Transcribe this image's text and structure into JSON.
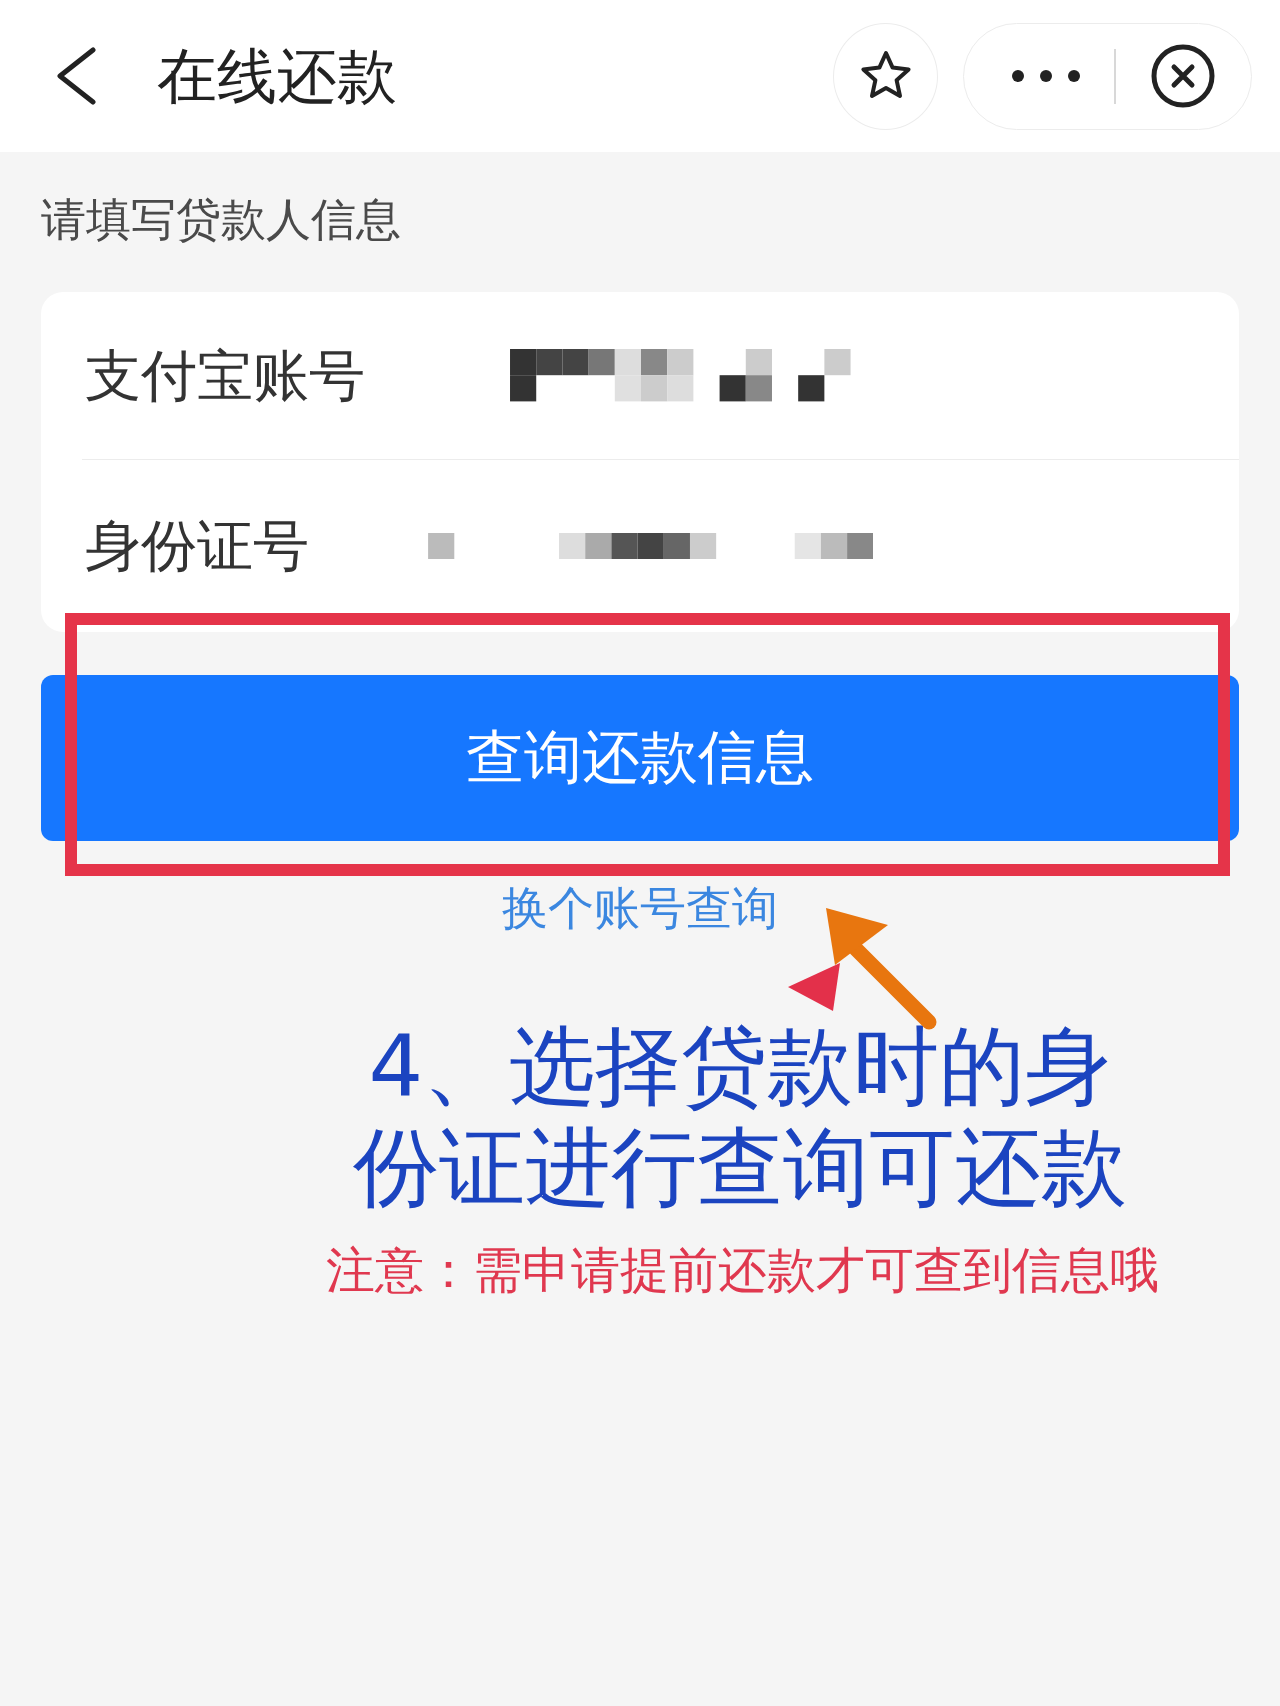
{
  "header": {
    "title": "在线还款"
  },
  "section_label": "请填写贷款人信息",
  "form": {
    "fields": [
      {
        "label": "支付宝账号",
        "masked": true
      },
      {
        "label": "身份证号",
        "masked": true
      }
    ]
  },
  "primary_button": {
    "label": "查询还款信息"
  },
  "switch_account_link": "换个账号查询",
  "annotation": {
    "step_text": "4、选择贷款时的身份证进行查询可还款",
    "note": "注意：需申请提前还款才可查到信息哦"
  }
}
